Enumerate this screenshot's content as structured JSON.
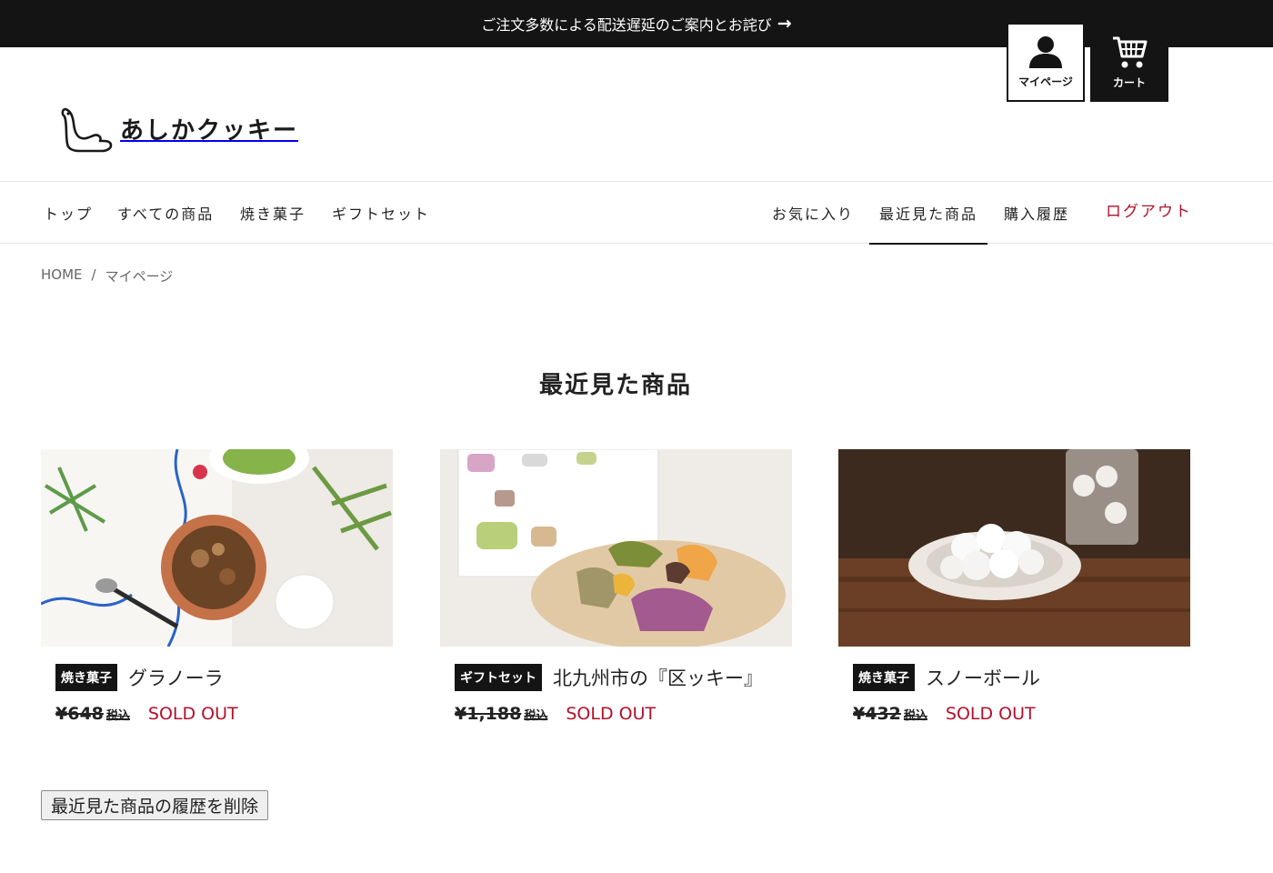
{
  "announcement": {
    "text": "ご注文多数による配送遅延のご案内とお詫び",
    "arrow": "→"
  },
  "logo": {
    "text": "あしかクッキー"
  },
  "header_buttons": {
    "mypage": "マイページ",
    "cart": "カート"
  },
  "nav": {
    "left": [
      "トップ",
      "すべての商品",
      "焼き菓子",
      "ギフトセット"
    ],
    "right": [
      "お気に入り",
      "最近見た商品",
      "購入履歴"
    ],
    "logout": "ログアウト",
    "active": "最近見た商品"
  },
  "breadcrumb": {
    "home": "HOME",
    "separator": "/",
    "current": "マイページ"
  },
  "page_title": "最近見た商品",
  "products": [
    {
      "tag": "焼き菓子",
      "name": "グラノーラ",
      "price": "¥648",
      "tax": "税込",
      "status": "SOLD OUT"
    },
    {
      "tag": "ギフトセット",
      "name": "北九州市の『区ッキー』",
      "price": "¥1,188",
      "tax": "税込",
      "status": "SOLD OUT"
    },
    {
      "tag": "焼き菓子",
      "name": "スノーボール",
      "price": "¥432",
      "tax": "税込",
      "status": "SOLD OUT"
    }
  ],
  "clear_history_button": "最近見た商品の履歴を削除",
  "colors": {
    "dark": "#141414",
    "accent_red": "#b3102b"
  }
}
